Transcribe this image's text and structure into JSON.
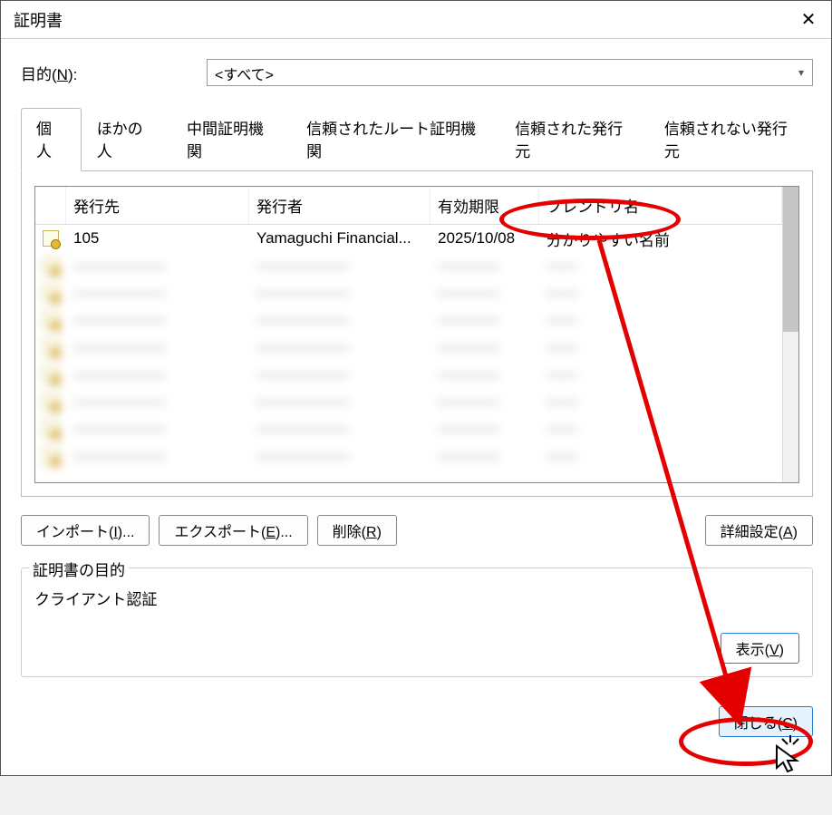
{
  "window": {
    "title": "証明書"
  },
  "purpose": {
    "label_pre": "目的(",
    "label_u": "N",
    "label_post": "):",
    "value": "<すべて>"
  },
  "tabs": [
    {
      "label": "個人",
      "active": true
    },
    {
      "label": "ほかの人"
    },
    {
      "label": "中間証明機関"
    },
    {
      "label": "信頼されたルート証明機関"
    },
    {
      "label": "信頼された発行元"
    },
    {
      "label": "信頼されない発行元"
    }
  ],
  "columns": {
    "issued_to": "発行先",
    "issued_by": "発行者",
    "expires": "有効期限",
    "friendly": "フレンドリ名"
  },
  "rows": [
    {
      "to": "105",
      "by": "Yamaguchi Financial...",
      "exp": "2025/10/08",
      "fr": "分かりやすい名前"
    },
    {
      "to": "——————",
      "by": "——————",
      "exp": "————",
      "fr": "——"
    },
    {
      "to": "——————",
      "by": "——————",
      "exp": "————",
      "fr": "——"
    },
    {
      "to": "——————",
      "by": "——————",
      "exp": "————",
      "fr": "——"
    },
    {
      "to": "——————",
      "by": "——————",
      "exp": "————",
      "fr": "——"
    },
    {
      "to": "——————",
      "by": "——————",
      "exp": "————",
      "fr": "——"
    },
    {
      "to": "——————",
      "by": "——————",
      "exp": "————",
      "fr": "——"
    },
    {
      "to": "——————",
      "by": "——————",
      "exp": "————",
      "fr": "——"
    },
    {
      "to": "——————",
      "by": "——————",
      "exp": "————",
      "fr": "——"
    }
  ],
  "buttons": {
    "import_pre": "インポート(",
    "import_u": "I",
    "import_post": ")...",
    "export_pre": "エクスポート(",
    "export_u": "E",
    "export_post": ")...",
    "remove_pre": "削除(",
    "remove_u": "R",
    "remove_post": ")",
    "advanced_pre": "詳細設定(",
    "advanced_u": "A",
    "advanced_post": ")",
    "view_pre": "表示(",
    "view_u": "V",
    "view_post": ")",
    "close_pre": "閉じる(",
    "close_u": "C",
    "close_post": ")"
  },
  "purpose_box": {
    "title": "証明書の目的",
    "text": "クライアント認証"
  }
}
